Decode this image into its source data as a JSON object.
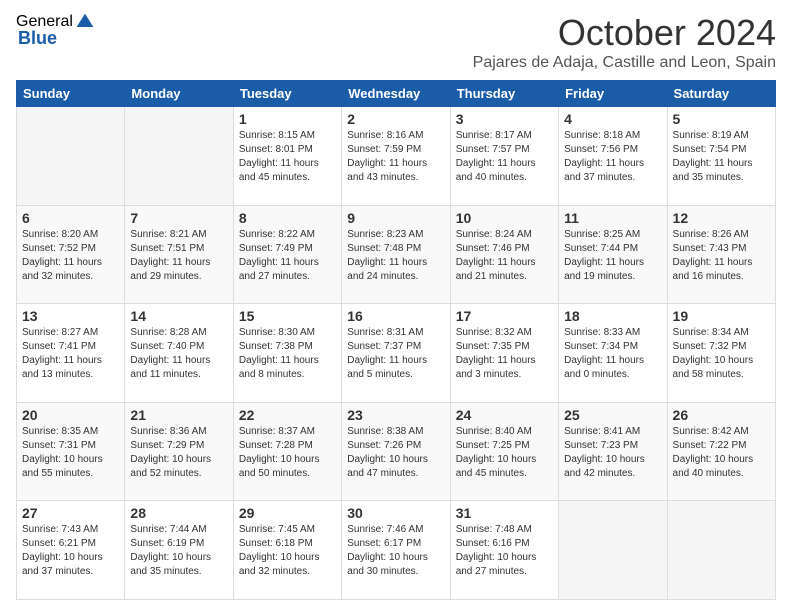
{
  "header": {
    "logo_general": "General",
    "logo_blue": "Blue",
    "month_title": "October 2024",
    "subtitle": "Pajares de Adaja, Castille and Leon, Spain"
  },
  "weekdays": [
    "Sunday",
    "Monday",
    "Tuesday",
    "Wednesday",
    "Thursday",
    "Friday",
    "Saturday"
  ],
  "weeks": [
    [
      {
        "day": "",
        "info": ""
      },
      {
        "day": "",
        "info": ""
      },
      {
        "day": "1",
        "info": "Sunrise: 8:15 AM\nSunset: 8:01 PM\nDaylight: 11 hours and 45 minutes."
      },
      {
        "day": "2",
        "info": "Sunrise: 8:16 AM\nSunset: 7:59 PM\nDaylight: 11 hours and 43 minutes."
      },
      {
        "day": "3",
        "info": "Sunrise: 8:17 AM\nSunset: 7:57 PM\nDaylight: 11 hours and 40 minutes."
      },
      {
        "day": "4",
        "info": "Sunrise: 8:18 AM\nSunset: 7:56 PM\nDaylight: 11 hours and 37 minutes."
      },
      {
        "day": "5",
        "info": "Sunrise: 8:19 AM\nSunset: 7:54 PM\nDaylight: 11 hours and 35 minutes."
      }
    ],
    [
      {
        "day": "6",
        "info": "Sunrise: 8:20 AM\nSunset: 7:52 PM\nDaylight: 11 hours and 32 minutes."
      },
      {
        "day": "7",
        "info": "Sunrise: 8:21 AM\nSunset: 7:51 PM\nDaylight: 11 hours and 29 minutes."
      },
      {
        "day": "8",
        "info": "Sunrise: 8:22 AM\nSunset: 7:49 PM\nDaylight: 11 hours and 27 minutes."
      },
      {
        "day": "9",
        "info": "Sunrise: 8:23 AM\nSunset: 7:48 PM\nDaylight: 11 hours and 24 minutes."
      },
      {
        "day": "10",
        "info": "Sunrise: 8:24 AM\nSunset: 7:46 PM\nDaylight: 11 hours and 21 minutes."
      },
      {
        "day": "11",
        "info": "Sunrise: 8:25 AM\nSunset: 7:44 PM\nDaylight: 11 hours and 19 minutes."
      },
      {
        "day": "12",
        "info": "Sunrise: 8:26 AM\nSunset: 7:43 PM\nDaylight: 11 hours and 16 minutes."
      }
    ],
    [
      {
        "day": "13",
        "info": "Sunrise: 8:27 AM\nSunset: 7:41 PM\nDaylight: 11 hours and 13 minutes."
      },
      {
        "day": "14",
        "info": "Sunrise: 8:28 AM\nSunset: 7:40 PM\nDaylight: 11 hours and 11 minutes."
      },
      {
        "day": "15",
        "info": "Sunrise: 8:30 AM\nSunset: 7:38 PM\nDaylight: 11 hours and 8 minutes."
      },
      {
        "day": "16",
        "info": "Sunrise: 8:31 AM\nSunset: 7:37 PM\nDaylight: 11 hours and 5 minutes."
      },
      {
        "day": "17",
        "info": "Sunrise: 8:32 AM\nSunset: 7:35 PM\nDaylight: 11 hours and 3 minutes."
      },
      {
        "day": "18",
        "info": "Sunrise: 8:33 AM\nSunset: 7:34 PM\nDaylight: 11 hours and 0 minutes."
      },
      {
        "day": "19",
        "info": "Sunrise: 8:34 AM\nSunset: 7:32 PM\nDaylight: 10 hours and 58 minutes."
      }
    ],
    [
      {
        "day": "20",
        "info": "Sunrise: 8:35 AM\nSunset: 7:31 PM\nDaylight: 10 hours and 55 minutes."
      },
      {
        "day": "21",
        "info": "Sunrise: 8:36 AM\nSunset: 7:29 PM\nDaylight: 10 hours and 52 minutes."
      },
      {
        "day": "22",
        "info": "Sunrise: 8:37 AM\nSunset: 7:28 PM\nDaylight: 10 hours and 50 minutes."
      },
      {
        "day": "23",
        "info": "Sunrise: 8:38 AM\nSunset: 7:26 PM\nDaylight: 10 hours and 47 minutes."
      },
      {
        "day": "24",
        "info": "Sunrise: 8:40 AM\nSunset: 7:25 PM\nDaylight: 10 hours and 45 minutes."
      },
      {
        "day": "25",
        "info": "Sunrise: 8:41 AM\nSunset: 7:23 PM\nDaylight: 10 hours and 42 minutes."
      },
      {
        "day": "26",
        "info": "Sunrise: 8:42 AM\nSunset: 7:22 PM\nDaylight: 10 hours and 40 minutes."
      }
    ],
    [
      {
        "day": "27",
        "info": "Sunrise: 7:43 AM\nSunset: 6:21 PM\nDaylight: 10 hours and 37 minutes."
      },
      {
        "day": "28",
        "info": "Sunrise: 7:44 AM\nSunset: 6:19 PM\nDaylight: 10 hours and 35 minutes."
      },
      {
        "day": "29",
        "info": "Sunrise: 7:45 AM\nSunset: 6:18 PM\nDaylight: 10 hours and 32 minutes."
      },
      {
        "day": "30",
        "info": "Sunrise: 7:46 AM\nSunset: 6:17 PM\nDaylight: 10 hours and 30 minutes."
      },
      {
        "day": "31",
        "info": "Sunrise: 7:48 AM\nSunset: 6:16 PM\nDaylight: 10 hours and 27 minutes."
      },
      {
        "day": "",
        "info": ""
      },
      {
        "day": "",
        "info": ""
      }
    ]
  ]
}
